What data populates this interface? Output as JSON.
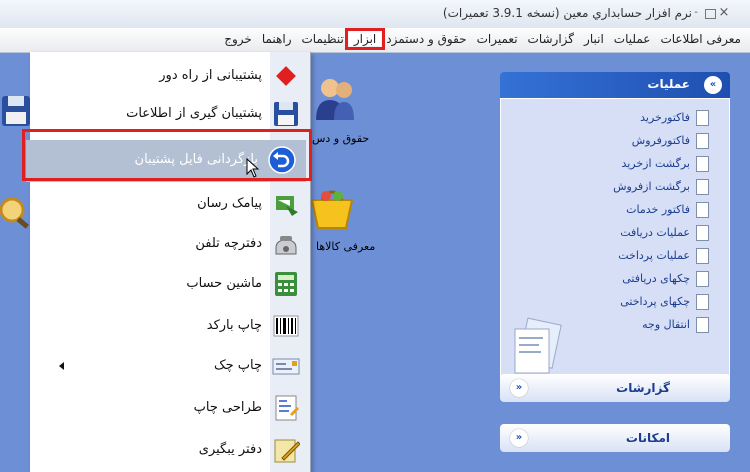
{
  "window": {
    "title": "نرم افزار حسابداري معين (نسخه 3.9.1 تعميرات)",
    "min": "-",
    "close": "×"
  },
  "menubar": [
    {
      "label": "معرفی اطلاعات"
    },
    {
      "label": "عملیات"
    },
    {
      "label": "انبار"
    },
    {
      "label": "گزارشات"
    },
    {
      "label": "تعمیرات"
    },
    {
      "label": "حقوق و دستمزد"
    },
    {
      "label": "ابزار",
      "active": true
    },
    {
      "label": "تنظیمات"
    },
    {
      "label": "راهنما"
    },
    {
      "label": "خروج"
    }
  ],
  "desktop": {
    "payroll_label": "حقوق و دس",
    "goods_label": "معرفی کالاها"
  },
  "tools_menu": [
    {
      "label": "پشتیبانی از راه دور"
    },
    {
      "label": "پشتیبان گیری از اطلاعات"
    },
    {
      "label": "بازگردانی فایل پشتیبان"
    },
    {
      "label": "پیامک رسان"
    },
    {
      "label": "دفترچه تلفن"
    },
    {
      "label": "ماشین حساب"
    },
    {
      "label": "چاپ بارکد"
    },
    {
      "label": "چاپ چک"
    },
    {
      "label": "طراحی چاپ"
    },
    {
      "label": "دفتر یبگیری"
    }
  ],
  "panel": {
    "title": "عملیات",
    "chevron": "«",
    "items": [
      "فاکتورخرید",
      "فاکتورفروش",
      "برگشت ازخرید",
      "برگشت ازفروش",
      "فاکتور خدمات",
      "عملیات دریافت",
      "عملیات پرداخت",
      "چکهای دریافتی",
      "چکهای پرداختی",
      "انتقال وجه"
    ]
  },
  "collapsed": [
    {
      "title": "گزارشات",
      "chevron": "»"
    },
    {
      "title": "امکانات",
      "chevron": "»"
    }
  ],
  "colors": {
    "accent": "#1e4fb0",
    "highlight": "#e02020",
    "background": "#6d8fd6"
  }
}
